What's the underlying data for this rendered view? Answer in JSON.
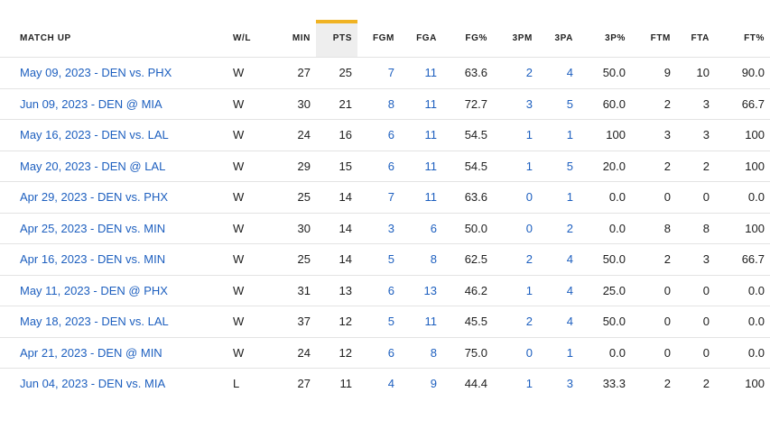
{
  "columns": [
    "MATCH UP",
    "W/L",
    "MIN",
    "PTS",
    "FGM",
    "FGA",
    "FG%",
    "3PM",
    "3PA",
    "3P%",
    "FTM",
    "FTA",
    "FT%"
  ],
  "sorted_column": "PTS",
  "accent_color": "#f0b323",
  "link_color": "#1d5fbf",
  "rows": [
    [
      "May 09, 2023 - DEN vs. PHX",
      "W",
      "27",
      "25",
      "7",
      "11",
      "63.6",
      "2",
      "4",
      "50.0",
      "9",
      "10",
      "90.0"
    ],
    [
      "Jun 09, 2023 - DEN @ MIA",
      "W",
      "30",
      "21",
      "8",
      "11",
      "72.7",
      "3",
      "5",
      "60.0",
      "2",
      "3",
      "66.7"
    ],
    [
      "May 16, 2023 - DEN vs. LAL",
      "W",
      "24",
      "16",
      "6",
      "11",
      "54.5",
      "1",
      "1",
      "100",
      "3",
      "3",
      "100"
    ],
    [
      "May 20, 2023 - DEN @ LAL",
      "W",
      "29",
      "15",
      "6",
      "11",
      "54.5",
      "1",
      "5",
      "20.0",
      "2",
      "2",
      "100"
    ],
    [
      "Apr 29, 2023 - DEN vs. PHX",
      "W",
      "25",
      "14",
      "7",
      "11",
      "63.6",
      "0",
      "1",
      "0.0",
      "0",
      "0",
      "0.0"
    ],
    [
      "Apr 25, 2023 - DEN vs. MIN",
      "W",
      "30",
      "14",
      "3",
      "6",
      "50.0",
      "0",
      "2",
      "0.0",
      "8",
      "8",
      "100"
    ],
    [
      "Apr 16, 2023 - DEN vs. MIN",
      "W",
      "25",
      "14",
      "5",
      "8",
      "62.5",
      "2",
      "4",
      "50.0",
      "2",
      "3",
      "66.7"
    ],
    [
      "May 11, 2023 - DEN @ PHX",
      "W",
      "31",
      "13",
      "6",
      "13",
      "46.2",
      "1",
      "4",
      "25.0",
      "0",
      "0",
      "0.0"
    ],
    [
      "May 18, 2023 - DEN vs. LAL",
      "W",
      "37",
      "12",
      "5",
      "11",
      "45.5",
      "2",
      "4",
      "50.0",
      "0",
      "0",
      "0.0"
    ],
    [
      "Apr 21, 2023 - DEN @ MIN",
      "W",
      "24",
      "12",
      "6",
      "8",
      "75.0",
      "0",
      "1",
      "0.0",
      "0",
      "0",
      "0.0"
    ],
    [
      "Jun 04, 2023 - DEN vs. MIA",
      "L",
      "27",
      "11",
      "4",
      "9",
      "44.4",
      "1",
      "3",
      "33.3",
      "2",
      "2",
      "100"
    ]
  ]
}
